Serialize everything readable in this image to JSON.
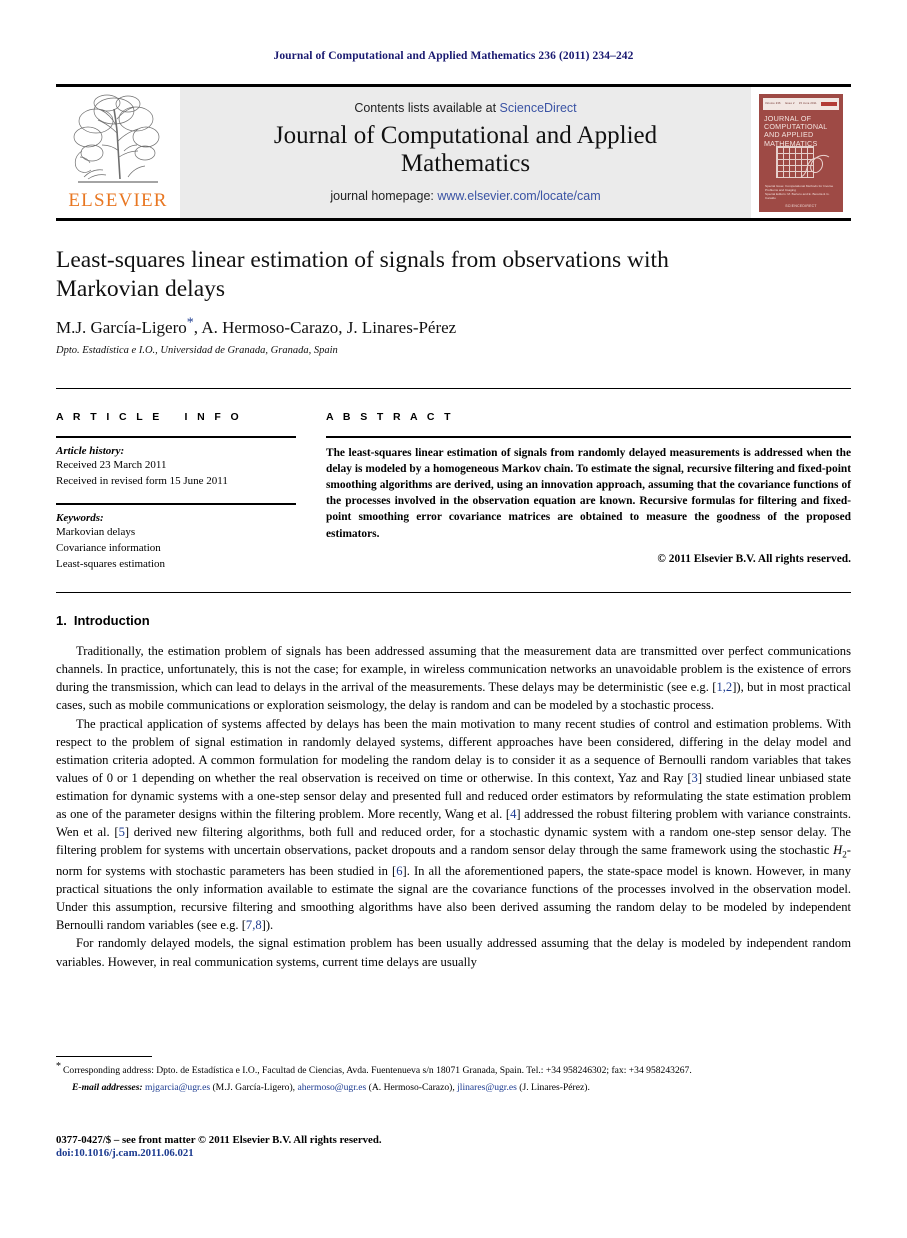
{
  "running_head": "Journal of Computational and Applied Mathematics 236 (2011) 234–242",
  "masthead": {
    "publisher_name": "ELSEVIER",
    "contents_prefix": "Contents lists available at ",
    "sciencedirect": "ScienceDirect",
    "journal_title": "Journal of Computational and Applied Mathematics",
    "homepage_prefix": "journal homepage: ",
    "homepage_url": "www.elsevier.com/locate/cam",
    "cover": {
      "masthead_left": "ELSEVIER",
      "topbar_left": "Volume 236",
      "topbar_mid": "Issue 2",
      "topbar_right": "15 June 2011",
      "topbar_far": "ISSN 0377-0427",
      "title": "JOURNAL OF COMPUTATIONAL AND APPLIED MATHEMATICS",
      "caption": "Special Issue: Computational Methods for Inverse Problems and Imaging",
      "editors": "Special Editors: M. Bertero and E. Beretta & G. Caraldo",
      "footer": "SCIENCEDIRECT"
    }
  },
  "article": {
    "title": "Least-squares linear estimation of signals from observations with Markovian delays",
    "authors": "M.J. García-Ligero",
    "authors_rest": ", A. Hermoso-Carazo, J. Linares-Pérez",
    "corresponding_marker": "*",
    "affiliation": "Dpto. Estadística e I.O., Universidad de Granada, Granada, Spain"
  },
  "article_info": {
    "section_label_a": "A R T I C L E",
    "section_label_b": "I N F O",
    "history_title": "Article history:",
    "history_lines": [
      "Received 23 March 2011",
      "Received in revised form 15 June 2011"
    ],
    "keywords_title": "Keywords:",
    "keywords": [
      "Markovian delays",
      "Covariance information",
      "Least-squares estimation"
    ]
  },
  "abstract": {
    "section_label": "A B S T R A C T",
    "text": "The least-squares linear estimation of signals from randomly delayed measurements is addressed when the delay is modeled by a homogeneous Markov chain. To estimate the signal, recursive filtering and fixed-point smoothing algorithms are derived, using an innovation approach, assuming that the covariance functions of the processes involved in the observation equation are known. Recursive formulas for filtering and fixed-point smoothing error covariance matrices are obtained to measure the goodness of the proposed estimators.",
    "copyright": "© 2011 Elsevier B.V. All rights reserved."
  },
  "introduction": {
    "number": "1.",
    "heading": "Introduction",
    "paragraph1_a": "Traditionally, the estimation problem of signals has been addressed assuming that the measurement data are transmitted over perfect communications channels. In practice, unfortunately, this is not the case; for example, in wireless communication networks an unavoidable problem is the existence of errors during the transmission, which can lead to delays in the arrival of the measurements. These delays may be deterministic (see e.g. [",
    "cite1": "1,2",
    "paragraph1_b": "]), but in most practical cases, such as mobile communications or exploration seismology, the delay is random and can be modeled by a stochastic process.",
    "paragraph2_a": "The practical application of systems affected by delays has been the main motivation to many recent studies of control and estimation problems. With respect to the problem of signal estimation in randomly delayed systems, different approaches have been considered, differing in the delay model and estimation criteria adopted. A common formulation for modeling the random delay is to consider it as a sequence of Bernoulli random variables that takes values of 0 or 1 depending on whether the real observation is received on time or otherwise. In this context, Yaz and Ray [",
    "cite2": "3",
    "paragraph2_b": "] studied linear unbiased state estimation for dynamic systems with a one-step sensor delay and presented full and reduced order estimators by reformulating the state estimation problem as one of the parameter designs within the filtering problem. More recently, Wang et al. [",
    "cite3": "4",
    "paragraph2_c": "] addressed the robust filtering problem with variance constraints. Wen et al. [",
    "cite4": "5",
    "paragraph2_d": "] derived new filtering algorithms, both full and reduced order, for a stochastic dynamic system with a random one-step sensor delay. The filtering problem for systems with uncertain observations, packet dropouts and a random sensor delay through the same framework using the stochastic ",
    "norm_symbol": "H",
    "norm_subscript": "2",
    "paragraph2_e": "-norm for systems with stochastic parameters has been studied in [",
    "cite5": "6",
    "paragraph2_f": "]. In all the aforementioned papers, the state-space model is known. However, in many practical situations the only information available to estimate the signal are the covariance functions of the processes involved in the observation model. Under this assumption, recursive filtering and smoothing algorithms have also been derived assuming the random delay to be modeled by independent Bernoulli random variables (see e.g. [",
    "cite6": "7,8",
    "paragraph2_g": "]).",
    "paragraph3": "For randomly delayed models, the signal estimation problem has been usually addressed assuming that the delay is modeled by independent random variables. However, in real communication systems, current time delays are usually"
  },
  "footnote": {
    "marker": "*",
    "corresponding": "Corresponding address: Dpto. de Estadística e I.O., Facultad de Ciencias, Avda. Fuentenueva s/n 18071 Granada, Spain. Tel.: +34 958246302; fax: +34 958243267.",
    "emails_label": "E-mail addresses:",
    "emails": [
      {
        "address": "mjgarcia@ugr.es",
        "owner": "(M.J. García-Ligero)"
      },
      {
        "address": "ahermoso@ugr.es",
        "owner": "(A. Hermoso-Carazo)"
      },
      {
        "address": "jlinares@ugr.es",
        "owner": "(J. Linares-Pérez)"
      }
    ]
  },
  "bottom_matter": {
    "front_matter": "0377-0427/$ – see front matter © 2011 Elsevier B.V. All rights reserved.",
    "doi": "doi:10.1016/j.cam.2011.06.021"
  },
  "colors": {
    "running_head": "#191970",
    "link": "#3a53a4",
    "citation": "#1b3a8f",
    "elsevier_orange": "#E87722",
    "banner_bg": "#ebebeb",
    "cover_red": "#9e4a45"
  }
}
